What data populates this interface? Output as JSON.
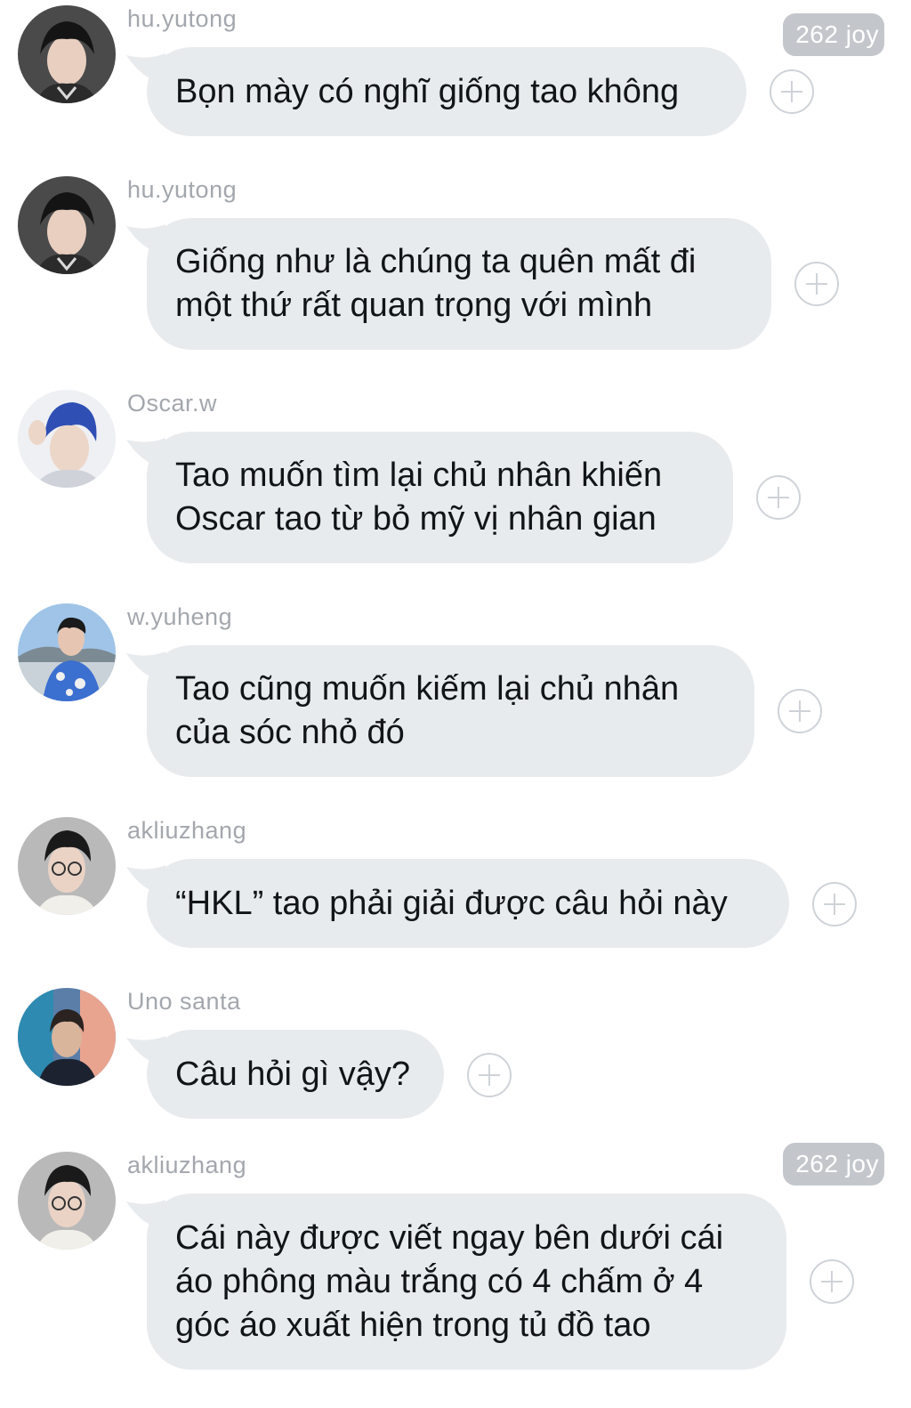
{
  "joy_label": "262 joy",
  "messages": [
    {
      "user": "hu.yutong",
      "text": "Bọn mày có nghĩ giống tao không",
      "joy": true,
      "avatar": "hu-yutong-avatar"
    },
    {
      "user": "hu.yutong",
      "text": "Giống như là chúng ta quên mất đi\nmột thứ rất quan trọng với mình",
      "joy": false,
      "avatar": "hu-yutong-avatar"
    },
    {
      "user": "Oscar.w",
      "text": "Tao muốn tìm lại chủ nhân khiến\nOscar tao từ bỏ mỹ vị nhân gian",
      "joy": false,
      "avatar": "oscar-w-avatar"
    },
    {
      "user": "w.yuheng",
      "text": "Tao cũng muốn kiếm lại chủ nhân\ncủa sóc nhỏ đó",
      "joy": false,
      "avatar": "w-yuheng-avatar"
    },
    {
      "user": "akliuzhang",
      "text": "“HKL” tao phải giải được câu hỏi này",
      "joy": false,
      "avatar": "akliuzhang-avatar"
    },
    {
      "user": "Uno santa",
      "text": "Câu hỏi gì vậy?",
      "joy": false,
      "avatar": "uno-santa-avatar"
    },
    {
      "user": "akliuzhang",
      "text": "Cái này được viết ngay bên dưới cái\náo phông màu trắng có 4 chấm ở 4\ngóc áo xuất hiện trong tủ đồ tao",
      "joy": true,
      "avatar": "akliuzhang-avatar"
    }
  ],
  "colors": {
    "bubble": "#e8ebee",
    "username": "#a3a7ad",
    "joy_badge": "#c3c7cc",
    "plus_icon": "#cfd3d8"
  },
  "icons": [
    "plus-circle-icon"
  ]
}
